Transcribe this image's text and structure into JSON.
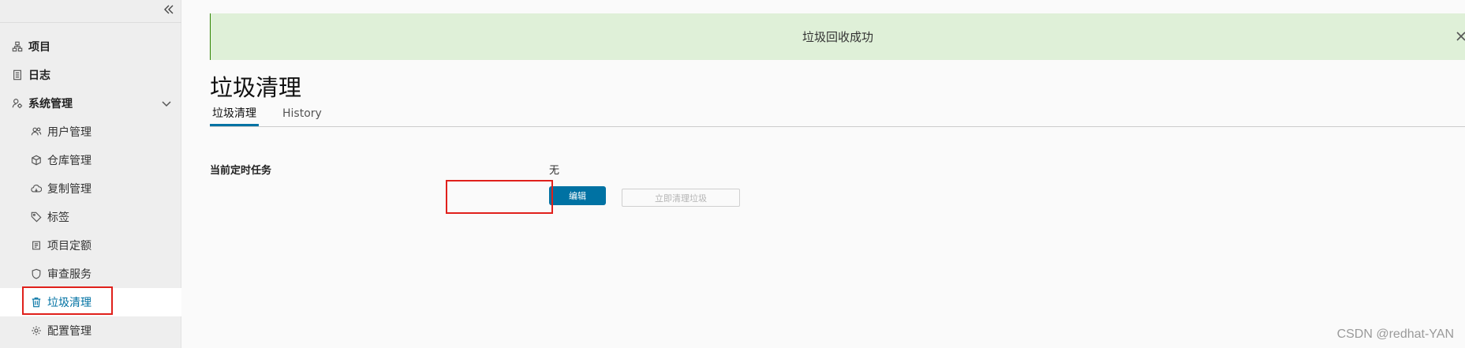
{
  "sidebar": {
    "collapse_icon": "double-chevron-left-icon",
    "items": [
      {
        "label": "项目",
        "icon": "projects-icon"
      },
      {
        "label": "日志",
        "icon": "logs-icon"
      },
      {
        "label": "系统管理",
        "icon": "admin-icon",
        "expanded": true
      },
      {
        "label": "用户管理",
        "icon": "users-icon"
      },
      {
        "label": "仓库管理",
        "icon": "registry-icon"
      },
      {
        "label": "复制管理",
        "icon": "replication-icon"
      },
      {
        "label": "标签",
        "icon": "tag-icon"
      },
      {
        "label": "项目定额",
        "icon": "quota-icon"
      },
      {
        "label": "审查服务",
        "icon": "shield-icon"
      },
      {
        "label": "垃圾清理",
        "icon": "trash-icon",
        "active": true
      },
      {
        "label": "配置管理",
        "icon": "gear-icon"
      }
    ]
  },
  "alert": {
    "message": "垃圾回收成功",
    "type": "success"
  },
  "page": {
    "title": "垃圾清理",
    "tabs": [
      {
        "label": "垃圾清理",
        "active": true
      },
      {
        "label": "History",
        "active": false
      }
    ],
    "schedule_label": "当前定时任务",
    "schedule_value": "无",
    "edit_button": "编辑",
    "gc_now_button": "立即清理垃圾"
  },
  "watermark": "CSDN @redhat-YAN",
  "colors": {
    "accent": "#0072a3",
    "success_bg": "#dff0d8",
    "highlight": "#e0201b"
  }
}
